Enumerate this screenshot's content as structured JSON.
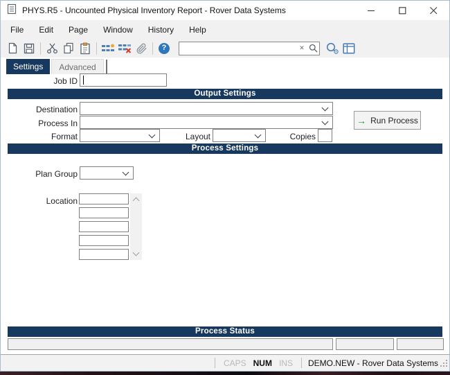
{
  "window": {
    "title": "PHYS.R5 - Uncounted Physical Inventory Report - Rover Data Systems"
  },
  "menu": {
    "items": [
      "File",
      "Edit",
      "Page",
      "Window",
      "History",
      "Help"
    ]
  },
  "toolbar": {
    "icons": [
      "new-document-icon",
      "save-icon",
      "cut-icon",
      "copy-icon",
      "paste-icon",
      "insert-row-icon",
      "delete-row-icon",
      "attachment-icon",
      "help-icon",
      "search-preview-icon",
      "layout-panel-icon"
    ],
    "search": {
      "value": "",
      "placeholder": ""
    }
  },
  "tabs": {
    "settings": "Settings",
    "advanced": "Advanced"
  },
  "form": {
    "job_id": {
      "label": "Job ID",
      "value": ""
    },
    "output": {
      "header": "Output Settings",
      "destination": {
        "label": "Destination",
        "value": ""
      },
      "process_in": {
        "label": "Process In",
        "value": ""
      },
      "format": {
        "label": "Format",
        "value": ""
      },
      "layout": {
        "label": "Layout",
        "value": ""
      },
      "copies": {
        "label": "Copies",
        "value": ""
      },
      "run_button": "Run Process"
    },
    "process": {
      "header": "Process Settings",
      "plan_group": {
        "label": "Plan Group",
        "value": ""
      },
      "location": {
        "label": "Location",
        "values": [
          "",
          "",
          "",
          "",
          ""
        ]
      }
    },
    "status": {
      "header": "Process Status",
      "fields": [
        "",
        "",
        ""
      ]
    }
  },
  "status_bar": {
    "caps": "CAPS",
    "num": "NUM",
    "ins": "INS",
    "session": "DEMO.NEW - Rover Data Systems"
  },
  "colors": {
    "accent_navy": "#17395f",
    "icon_blue": "#4d7fb5",
    "help_blue": "#2f77bd",
    "run_green": "#169b39",
    "delete_red": "#d23b2e",
    "add_orange": "#f0a42c",
    "frame_blue": "#a9bdd1"
  }
}
